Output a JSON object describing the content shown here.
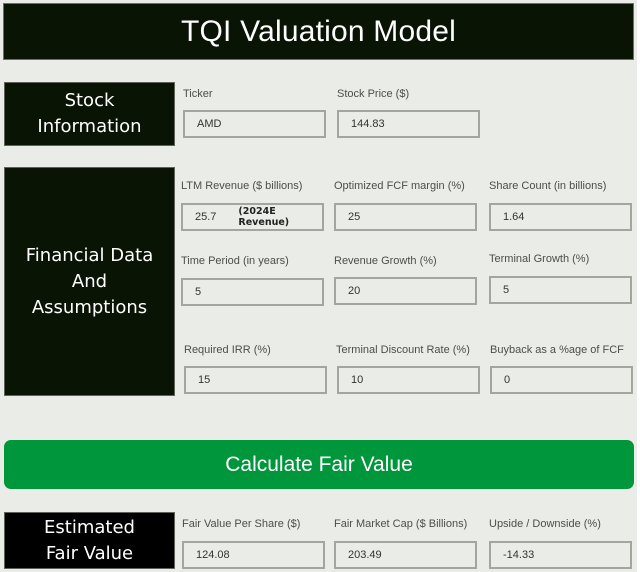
{
  "header": {
    "title": "TQI Valuation Model"
  },
  "sections": {
    "stock_info": {
      "label": "Stock\nInformation",
      "fields": [
        {
          "label": "Ticker",
          "value": "AMD"
        },
        {
          "label": "Stock Price ($)",
          "value": "144.83"
        }
      ]
    },
    "financial": {
      "label": "Financial Data\nAnd\nAssumptions",
      "fields": [
        {
          "label": "LTM Revenue ($ billions)",
          "value": "25.7",
          "note": "(2024E Revenue)"
        },
        {
          "label": "Optimized FCF margin (%)",
          "value": "25"
        },
        {
          "label": "Share Count (in billions)",
          "value": "1.64"
        },
        {
          "label": "Time Period (in years)",
          "value": "5"
        },
        {
          "label": "Revenue Growth (%)",
          "value": "20"
        },
        {
          "label": "Terminal Growth (%)",
          "value": "5"
        },
        {
          "label": "Required IRR (%)",
          "value": "15"
        },
        {
          "label": "Terminal Discount Rate (%)",
          "value": "10"
        },
        {
          "label": "Buyback as a %age of FCF",
          "value": "0"
        }
      ]
    },
    "fair_value": {
      "label": "Estimated\nFair Value",
      "fields": [
        {
          "label": "Fair Value Per Share ($)",
          "value": "124.08"
        },
        {
          "label": "Fair Market Cap ($ Billions)",
          "value": "203.49"
        },
        {
          "label": "Upside / Downside (%)",
          "value": "-14.33"
        }
      ]
    }
  },
  "actions": {
    "calculate_label": "Calculate Fair Value"
  },
  "colors": {
    "dark": "#0a1405",
    "accent_green": "#00963b",
    "background": "#eaece7"
  }
}
